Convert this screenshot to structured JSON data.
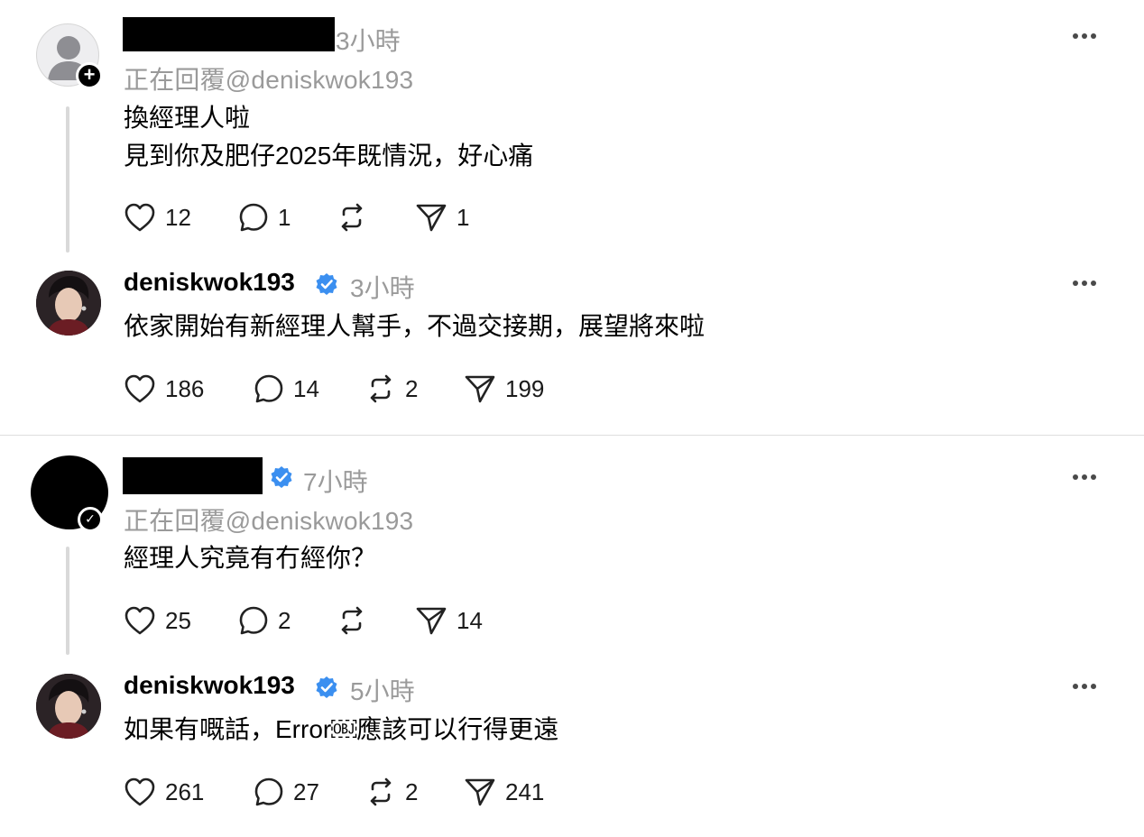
{
  "posts": [
    {
      "time": "3小時",
      "reply_to": "正在回覆@deniskwok193",
      "lines": [
        "換經理人啦",
        "見到你及肥仔2025年既情況，好心痛"
      ],
      "likes": "12",
      "comments": "1",
      "reposts": "",
      "shares": "1"
    },
    {
      "username": "deniskwok193",
      "time": "3小時",
      "lines": [
        "依家開始有新經理人幫手，不過交接期，展望將來啦"
      ],
      "likes": "186",
      "comments": "14",
      "reposts": "2",
      "shares": "199"
    },
    {
      "time": "7小時",
      "reply_to": "正在回覆@deniskwok193",
      "lines": [
        "經理人究竟有冇經你？"
      ],
      "likes": "25",
      "comments": "2",
      "reposts": "",
      "shares": "14"
    },
    {
      "username": "deniskwok193",
      "time": "5小時",
      "lines": [
        "如果有嘅話，Error￼應該可以行得更遠"
      ],
      "likes": "261",
      "comments": "27",
      "reposts": "2",
      "shares": "241"
    }
  ],
  "colors": {
    "verified": "#3b8ff0",
    "muted": "#9a9a9a",
    "thread_line": "#d9d9d9"
  },
  "icons": [
    "heart-icon",
    "comment-icon",
    "repost-icon",
    "share-icon",
    "more-icon",
    "verified-icon",
    "follow-plus-icon"
  ]
}
